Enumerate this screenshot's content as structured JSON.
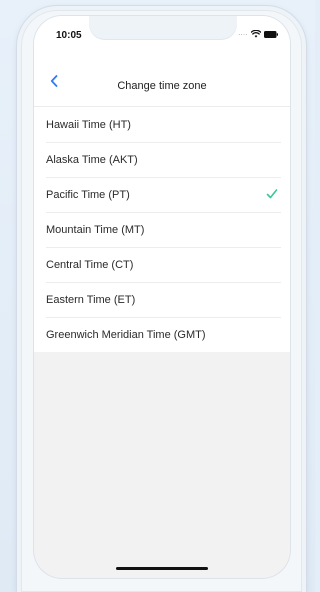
{
  "status_bar": {
    "time": "10:05",
    "signal": "....",
    "icons": [
      "signal-dots-icon",
      "wifi-icon",
      "battery-icon"
    ]
  },
  "nav": {
    "back_icon": "chevron-left-icon",
    "title": "Change time zone",
    "accent_color": "#2f7cf6"
  },
  "time_zones": [
    {
      "label": "Hawaii Time (HT)",
      "selected": false
    },
    {
      "label": "Alaska Time (AKT)",
      "selected": false
    },
    {
      "label": "Pacific Time (PT)",
      "selected": true
    },
    {
      "label": "Mountain Time (MT)",
      "selected": false
    },
    {
      "label": "Central Time (CT)",
      "selected": false
    },
    {
      "label": "Eastern Time (ET)",
      "selected": false
    },
    {
      "label": "Greenwich Meridian Time (GMT)",
      "selected": false
    }
  ],
  "check_color": "#3cc79a",
  "check_icon": "checkmark-icon"
}
